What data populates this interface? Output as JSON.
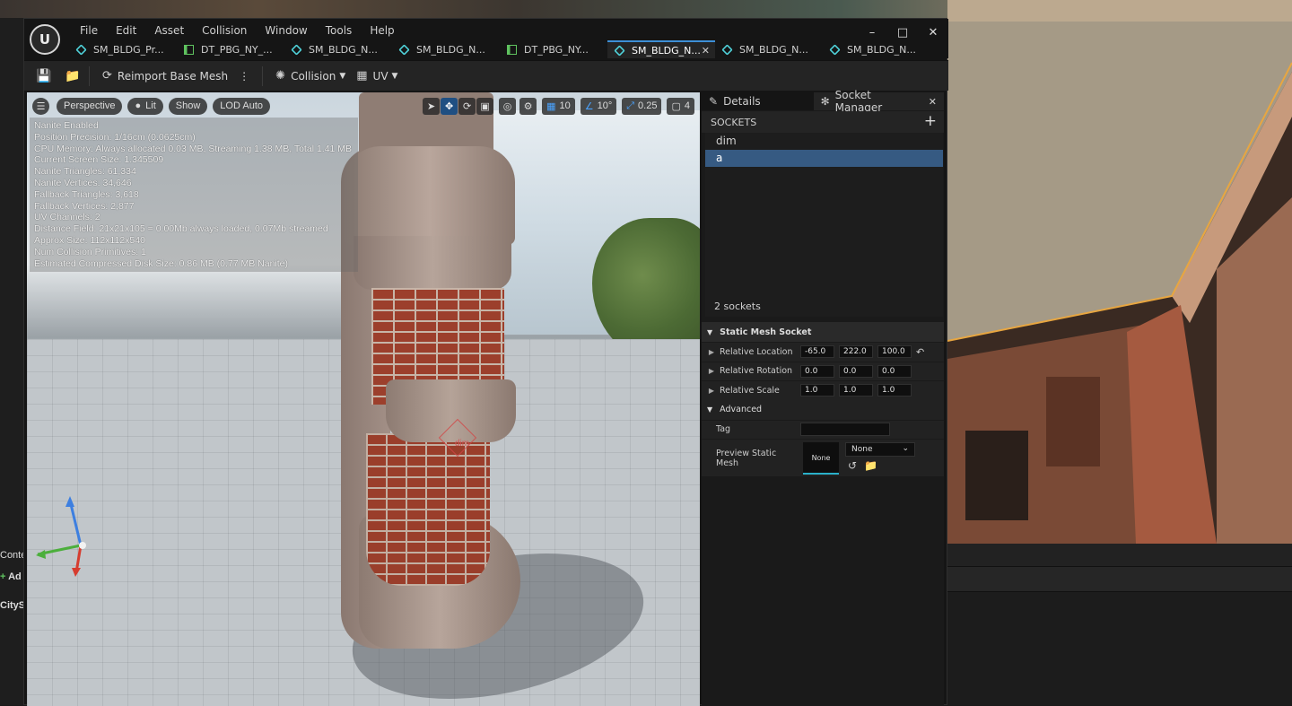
{
  "menu": [
    "File",
    "Edit",
    "Asset",
    "Collision",
    "Window",
    "Tools",
    "Help"
  ],
  "tabs": [
    {
      "label": "SM_BLDG_Pr...",
      "icon": "mesh"
    },
    {
      "label": "DT_PBG_NY_...",
      "icon": "table"
    },
    {
      "label": "SM_BLDG_N...",
      "icon": "mesh"
    },
    {
      "label": "SM_BLDG_N...",
      "icon": "mesh"
    },
    {
      "label": "DT_PBG_NY...",
      "icon": "table"
    },
    {
      "label": "SM_BLDG_N...",
      "icon": "mesh",
      "active": true
    },
    {
      "label": "SM_BLDG_N...",
      "icon": "mesh"
    },
    {
      "label": "SM_BLDG_N...",
      "icon": "mesh"
    }
  ],
  "toolbar": {
    "reimport": "Reimport Base Mesh",
    "collision": "Collision",
    "uv": "UV"
  },
  "viewport": {
    "perspective": "Perspective",
    "lit": "Lit",
    "show": "Show",
    "lod": "LOD Auto",
    "grid_snap": "10",
    "rot_snap": "10°",
    "scale_snap": "0.25",
    "camera_speed": "4",
    "socket_label": "dim"
  },
  "stats": [
    "Nanite Enabled",
    "Position Precision: 1/16cm (0.0625cm)",
    "CPU Memory: Always allocated 0.03 MB, Streaming 1.38 MB, Total 1.41 MB",
    "Current Screen Size: 1.345509",
    "Nanite Triangles: 61,334",
    "Nanite Vertices: 34,646",
    "Fallback Triangles: 3,618",
    "Fallback Vertices: 2,877",
    "UV Channels: 2",
    "Distance Field: 21x21x105 = 0.00Mb always loaded, 0.07Mb streamed",
    "Approx Size: 112x112x540",
    "Num Collision Primitives: 1",
    "Estimated Compressed Disk Size: 0.86 MB (0.77 MB Nanite)"
  ],
  "panel": {
    "details_tab": "Details",
    "socket_tab": "Socket Manager",
    "sockets_header": "SOCKETS",
    "sockets": [
      "dim",
      "a"
    ],
    "selected_socket": "a",
    "socket_count": "2 sockets",
    "category": "Static Mesh Socket",
    "location_label": "Relative Location",
    "location": [
      "-65.0",
      "222.0",
      "100.0"
    ],
    "rotation_label": "Relative Rotation",
    "rotation": [
      "0.0",
      "0.0",
      "0.0"
    ],
    "scale_label": "Relative Scale",
    "scale": [
      "1.0",
      "1.0",
      "1.0"
    ],
    "advanced": "Advanced",
    "tag_label": "Tag",
    "tag_value": "",
    "preview_label": "Preview Static Mesh",
    "preview_thumb": "None",
    "preview_combo": "None"
  },
  "left_fragments": [
    "Conte",
    "Ad",
    "CitySa"
  ]
}
